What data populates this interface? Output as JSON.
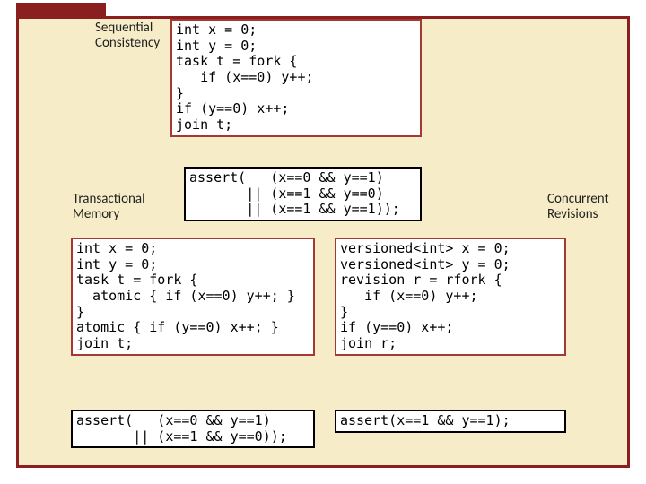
{
  "labels": {
    "seq": "Sequential\nConsistency",
    "tm": "Transactional\nMemory",
    "cr": "Concurrent\nRevisions"
  },
  "seq": {
    "code": "int x = 0;\nint y = 0;\ntask t = fork {\n   if (x==0) y++;\n}\nif (y==0) x++;\njoin t;",
    "assert": "assert(   (x==0 && y==1)\n       || (x==1 && y==0)\n       || (x==1 && y==1));"
  },
  "tm": {
    "code": "int x = 0;\nint y = 0;\ntask t = fork {\n  atomic { if (x==0) y++; }\n}\natomic { if (y==0) x++; }\njoin t;",
    "assert": "assert(   (x==0 && y==1)\n       || (x==1 && y==0));"
  },
  "cr": {
    "code": "versioned<int> x = 0;\nversioned<int> y = 0;\nrevision r = rfork {\n   if (x==0) y++;\n}\nif (y==0) x++;\njoin r;",
    "assert": "assert(x==1 && y==1);"
  }
}
